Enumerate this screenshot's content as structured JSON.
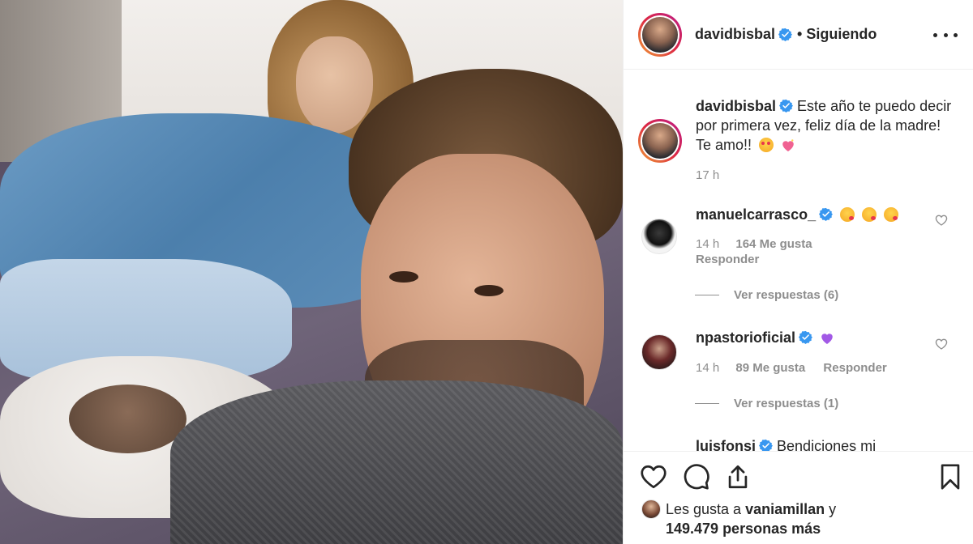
{
  "post": {
    "author": "davidbisbal",
    "follow_state": "• Siguiendo",
    "caption": "Este año te puedo decir por primera vez, feliz día de la madre! Te amo!!",
    "caption_emojis": [
      "smiling-face-with-heart-eyes",
      "sparkling-heart"
    ],
    "caption_time": "17 h"
  },
  "comments": [
    {
      "username": "manuelcarrasco_",
      "verified": true,
      "emojis": [
        "face-blowing-kiss",
        "face-blowing-kiss",
        "face-blowing-kiss"
      ],
      "time": "14 h",
      "likes": "164 Me gusta",
      "reply": "Responder",
      "view_replies": "Ver respuestas (6)"
    },
    {
      "username": "npastorioficial",
      "verified": true,
      "emojis": [
        "purple-heart"
      ],
      "time": "14 h",
      "likes": "89 Me gusta",
      "reply": "Responder",
      "view_replies": "Ver respuestas (1)"
    },
    {
      "username": "luisfonsi",
      "verified": true,
      "text": "Bendiciones mi"
    }
  ],
  "likes_summary": {
    "prefix": "Les gusta a",
    "user": "vaniamillan",
    "connector": "y",
    "others": "149.479 personas más"
  },
  "icons": {
    "like": "heart-icon",
    "comment": "comment-icon",
    "share": "share-icon",
    "save": "bookmark-icon",
    "more": "more-options-icon",
    "verified": "verified-badge-icon"
  },
  "colors": {
    "text": "#262626",
    "muted": "#8e8e8e",
    "verified": "#3897f0",
    "border": "#efefef"
  }
}
